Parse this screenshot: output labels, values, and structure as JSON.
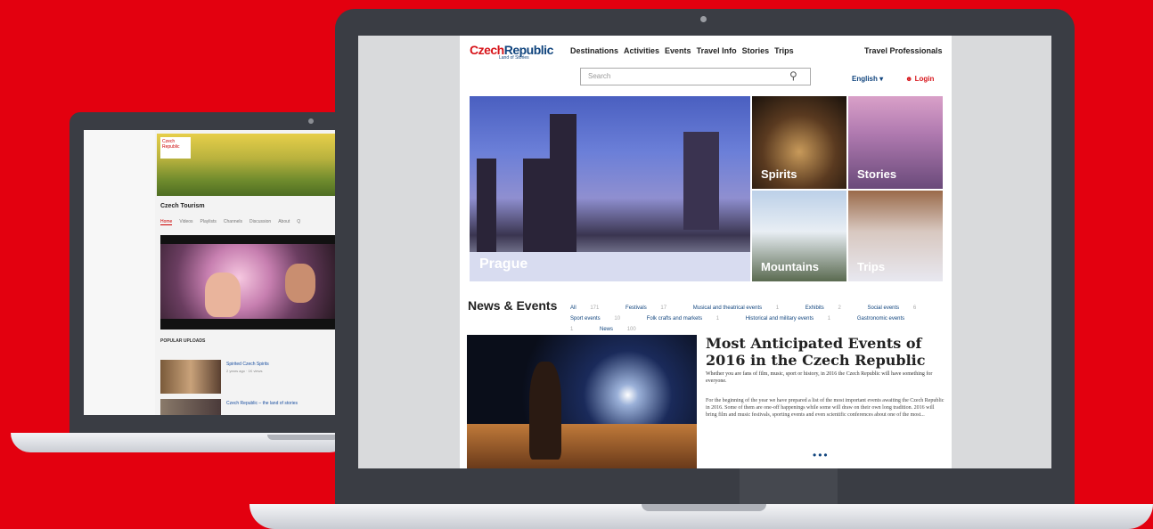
{
  "colors": {
    "background": "#e3000f",
    "accent_red": "#d7141a",
    "accent_blue": "#11457e"
  },
  "small_laptop": {
    "channel_logo_text": "Czech Republic",
    "channel_name": "Czech Tourism",
    "tabs": [
      "Home",
      "Videos",
      "Playlists",
      "Channels",
      "Discussion",
      "About",
      "Q"
    ],
    "section_title": "POPULAR UPLOADS",
    "videos": [
      {
        "title": "Spirited Czech Spirits",
        "meta": "2 years ago · 1K views"
      },
      {
        "title": "Czech Republic – the land of stories"
      }
    ]
  },
  "site": {
    "logo_czech": "Czech",
    "logo_republic": "Republic",
    "logo_sub": "Land of Stories",
    "nav": [
      "Destinations",
      "Activities",
      "Events",
      "Travel Info",
      "Stories",
      "Trips"
    ],
    "travel_pro": "Travel Professionals",
    "search_placeholder": "Search",
    "search_icon": "magnifier-icon",
    "language": "English ▾",
    "login": "Login",
    "hero_label": "Prague",
    "tiles": [
      "Spirits",
      "Stories",
      "Mountains",
      "Trips"
    ],
    "news_heading": "News & Events",
    "filters": [
      {
        "label": "All",
        "count": "171"
      },
      {
        "label": "Festivals",
        "count": "17"
      },
      {
        "label": "Musical and theatrical events",
        "count": "1"
      },
      {
        "label": "Exhibits",
        "count": "2"
      },
      {
        "label": "Social events",
        "count": "6"
      },
      {
        "label": "Sport events",
        "count": "10"
      },
      {
        "label": "Folk crafts and markets",
        "count": "1"
      },
      {
        "label": "Historical and military events",
        "count": "1"
      },
      {
        "label": "Gastronomic events",
        "count": "1"
      },
      {
        "label": "News",
        "count": "100"
      }
    ],
    "feature_title": "Most Anticipated Events of 2016 in the Czech Republic",
    "feature_sub": "Whether you are fans of film, music, sport or history, in 2016 the Czech Republic will have something for everyone.",
    "feature_body": "For the beginning of the year we have prepared a list of the most important events awaiting the Czech Republic in 2016. Some of them are one-off happenings while some will draw on their own long tradition. 2016 will bring film and music festivals, sporting events and even scientific conferences about one of the most...",
    "more_dots": "•••"
  }
}
